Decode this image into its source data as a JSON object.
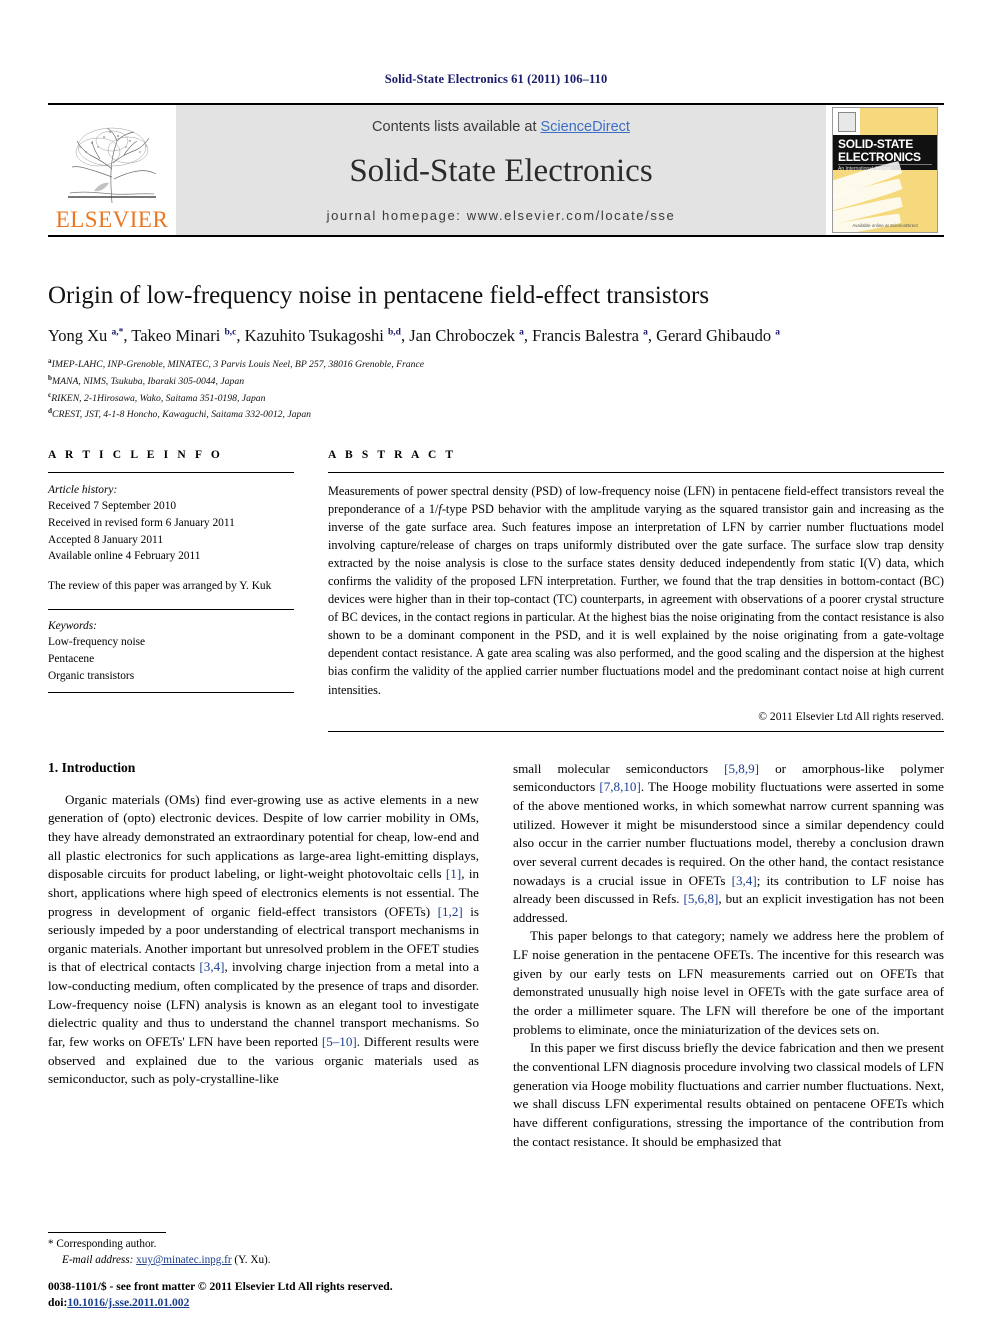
{
  "running_head": "Solid-State Electronics 61 (2011) 106–110",
  "masthead": {
    "contents_prefix": "Contents lists available at ",
    "sciencedirect": "ScienceDirect",
    "journal_name": "Solid-State Electronics",
    "homepage": "journal homepage: www.elsevier.com/locate/sse",
    "publisher_logo_text": "ELSEVIER",
    "publisher_logo_icon": "elsevier-tree-icon",
    "cover": {
      "line1": "SOLID-STATE",
      "line2": "ELECTRONICS",
      "subtitle": "An International Journal",
      "footer": "Available online at ScienceDirect"
    },
    "colors": {
      "link": "#3b6ec6",
      "elsevier_orange": "#E87722",
      "cover_yellow": "#f5d97c"
    }
  },
  "title": "Origin of low-frequency noise in pentacene field-effect transistors",
  "authors_html": "Yong Xu <sup>a,*</sup>, Takeo Minari <sup>b,c</sup>, Kazuhito Tsukagoshi <sup>b,d</sup>, Jan Chroboczek <sup>a</sup>, Francis Balestra <sup>a</sup>, Gerard Ghibaudo <sup>a</sup>",
  "affiliations": [
    {
      "marker": "a",
      "text": "IMEP-LAHC, INP-Grenoble, MINATEC, 3 Parvis Louis Neel, BP 257, 38016 Grenoble, France"
    },
    {
      "marker": "b",
      "text": "MANA, NIMS, Tsukuba, Ibaraki 305-0044, Japan"
    },
    {
      "marker": "c",
      "text": "RIKEN, 2-1Hirosawa, Wako, Saitama 351-0198, Japan"
    },
    {
      "marker": "d",
      "text": "CREST, JST, 4-1-8 Honcho, Kawaguchi, Saitama 332-0012, Japan"
    }
  ],
  "article_info": {
    "heading": "A R T I C L E   I N F O",
    "history_label": "Article history:",
    "history": [
      "Received 7 September 2010",
      "Received in revised form 6 January 2011",
      "Accepted 8 January 2011",
      "Available online 4 February 2011"
    ],
    "review_note": "The review of this paper was arranged by Y. Kuk",
    "keywords_label": "Keywords:",
    "keywords": [
      "Low-frequency noise",
      "Pentacene",
      "Organic transistors"
    ]
  },
  "abstract": {
    "heading": "A B S T R A C T",
    "text": "Measurements of power spectral density (PSD) of low-frequency noise (LFN) in pentacene field-effect transistors reveal the preponderance of a 1/f-type PSD behavior with the amplitude varying as the squared transistor gain and increasing as the inverse of the gate surface area. Such features impose an interpretation of LFN by carrier number fluctuations model involving capture/release of charges on traps uniformly distributed over the gate surface. The surface slow trap density extracted by the noise analysis is close to the surface states density deduced independently from static I(V) data, which confirms the validity of the proposed LFN interpretation. Further, we found that the trap densities in bottom-contact (BC) devices were higher than in their top-contact (TC) counterparts, in agreement with observations of a poorer crystal structure of BC devices, in the contact regions in particular. At the highest bias the noise originating from the contact resistance is also shown to be a dominant component in the PSD, and it is well explained by the noise originating from a gate-voltage dependent contact resistance. A gate area scaling was also performed, and the good scaling and the dispersion at the highest bias confirm the validity of the applied carrier number fluctuations model and the predominant contact noise at high current intensities.",
    "copyright": "© 2011 Elsevier Ltd All rights reserved."
  },
  "sections": {
    "intro_heading": "1. Introduction",
    "left_paragraphs": [
      "Organic materials (OMs) find ever-growing use as active elements in a new generation of (opto) electronic devices. Despite of low carrier mobility in OMs, they have already demonstrated an extraordinary potential for cheap, low-end and all plastic electronics for such applications as large-area light-emitting displays, disposable circuits for product labeling, or light-weight photovoltaic cells [1], in short, applications where high speed of electronics elements is not essential. The progress in development of organic field-effect transistors (OFETs) [1,2] is seriously impeded by a poor understanding of electrical transport mechanisms in organic materials. Another important but unresolved problem in the OFET studies is that of electrical contacts [3,4], involving charge injection from a metal into a low-conducting medium, often complicated by the presence of traps and disorder. Low-frequency noise (LFN) analysis is known as an elegant tool to investigate dielectric quality and thus to understand the channel transport mechanisms. So far, few works on OFETs' LFN have been reported [5–10]. Different results were observed and explained due to the various organic materials used as semiconductor, such as poly-crystalline-like"
    ],
    "right_paragraphs": [
      "small molecular semiconductors [5,8,9] or amorphous-like polymer semiconductors [7,8,10]. The Hooge mobility fluctuations were asserted in some of the above mentioned works, in which somewhat narrow current spanning was utilized. However it might be misunderstood since a similar dependency could also occur in the carrier number fluctuations model, thereby a conclusion drawn over several current decades is required. On the other hand, the contact resistance nowadays is a crucial issue in OFETs [3,4]; its contribution to LF noise has already been discussed in Refs. [5,6,8], but an explicit investigation has not been addressed.",
      "This paper belongs to that category; namely we address here the problem of LF noise generation in the pentacene OFETs. The incentive for this research was given by our early tests on LFN measurements carried out on OFETs that demonstrated unusually high noise level in OFETs with the gate surface area of the order a millimeter square. The LFN will therefore be one of the important problems to eliminate, once the miniaturization of the devices sets on.",
      "In this paper we first discuss briefly the device fabrication and then we present the conventional LFN diagnosis procedure involving two classical models of LFN generation via Hooge mobility fluctuations and carrier number fluctuations. Next, we shall discuss LFN experimental results obtained on pentacene OFETs which have different configurations, stressing the importance of the contribution from the contact resistance. It should be emphasized that"
    ]
  },
  "footnote": {
    "corresponding": "* Corresponding author.",
    "email_label": "E-mail address:",
    "email": "xuy@minatec.inpg.fr",
    "email_suffix": "(Y. Xu)."
  },
  "bottom": {
    "front_matter": "0038-1101/$ - see front matter © 2011 Elsevier Ltd All rights reserved.",
    "doi_label": "doi:",
    "doi": "10.1016/j.sse.2011.01.002"
  }
}
